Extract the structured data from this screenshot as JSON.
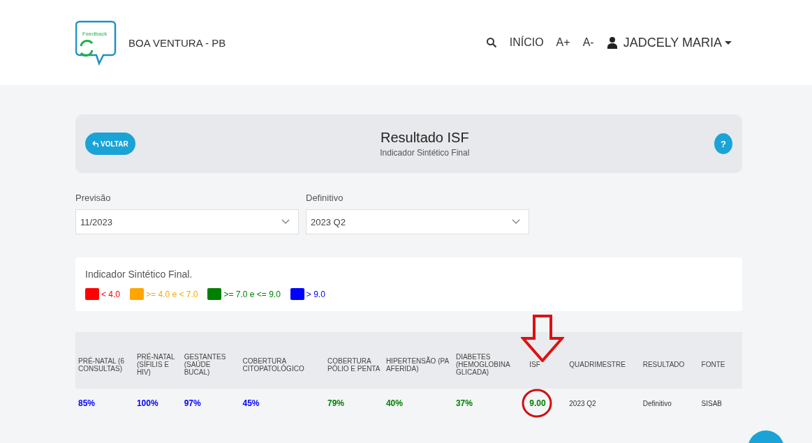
{
  "header": {
    "logo_text": "Feedback",
    "city": "BOA VENTURA - PB",
    "nav": [
      {
        "kind": "search"
      },
      {
        "kind": "link",
        "label": "INÍCIO"
      },
      {
        "kind": "link",
        "label": "A+"
      },
      {
        "kind": "link",
        "label": "A-"
      },
      {
        "kind": "user",
        "label": "JADCELY MARIA"
      }
    ]
  },
  "title_card": {
    "back_button": "VOLTAR",
    "title": "Resultado ISF",
    "subtitle": "Indicador Sintético Final",
    "help_button": "?"
  },
  "filters": [
    {
      "label": "Previsão",
      "value": "11/2023"
    },
    {
      "label": "Definitivo",
      "value": "2023 Q2"
    }
  ],
  "legend": {
    "title": "Indicador Sintético Final.",
    "items": [
      {
        "color": "#ff0000",
        "label": "< 4.0"
      },
      {
        "color": "#ffa500",
        "label": ">= 4.0 e < 7.0"
      },
      {
        "color": "#008000",
        "label": ">= 7.0 e <= 9.0"
      },
      {
        "color": "#0000ff",
        "label": "> 9.0"
      }
    ]
  },
  "table": {
    "columns": [
      "PRÉ-NATAL (6 CONSULTAS)",
      "PRÉ-NATAL (SÍFILIS E HIV)",
      "GESTANTES (SAÚDE BUCAL)",
      "COBERTURA CITOPATOLÓGICO",
      "COBERTURA PÓLIO E PENTA",
      "HIPERTENSÃO (PA AFERIDA)",
      "DIABETES (HEMOGLOBINA GLICADA)",
      "ISF",
      "QUADRIMESTRE",
      "RESULTADO",
      "FONTE"
    ],
    "rows": [
      [
        {
          "text": "85%",
          "color": "#0000ff"
        },
        {
          "text": "100%",
          "color": "#0000ff"
        },
        {
          "text": "97%",
          "color": "#0000ff"
        },
        {
          "text": "45%",
          "color": "#0000ff"
        },
        {
          "text": "79%",
          "color": "#008000"
        },
        {
          "text": "40%",
          "color": "#008000"
        },
        {
          "text": "37%",
          "color": "#008000"
        },
        {
          "text": "9.00",
          "color": "#008000",
          "highlighted": true
        },
        {
          "text": "2023 Q2"
        },
        {
          "text": "Definitivo"
        },
        {
          "text": "SISAB"
        }
      ]
    ]
  }
}
